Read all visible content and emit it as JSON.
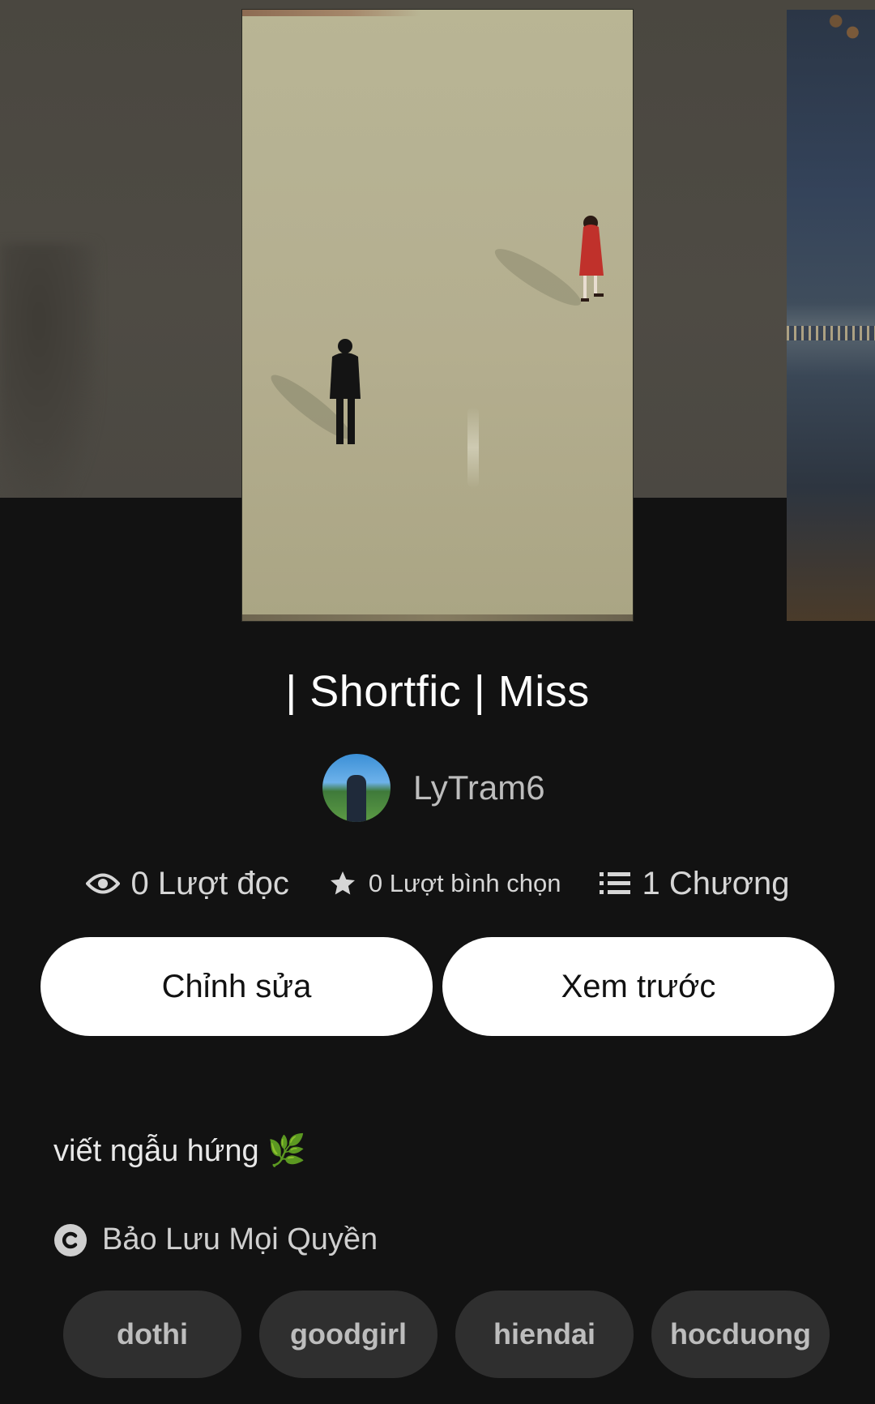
{
  "story": {
    "title": "| Shortfic | Miss",
    "author": "LyTram6",
    "description": "viết ngẫu hứng 🌿",
    "license": "Bảo Lưu Mọi Quyền"
  },
  "stats": {
    "reads": "0 Lượt đọc",
    "votes": "0 Lượt bình chọn",
    "chapters": "1 Chương"
  },
  "actions": {
    "edit_label": "Chỉnh sửa",
    "preview_label": "Xem trước"
  },
  "tags": [
    "dothi",
    "goodgirl",
    "hiendai",
    "hocduong"
  ],
  "icons": {
    "reads": "eye-icon",
    "votes": "star-icon",
    "chapters": "list-icon",
    "license": "copyright-icon"
  },
  "colors": {
    "background": "#121212",
    "button_bg": "#ffffff",
    "tag_bg": "#2f2f2f"
  }
}
